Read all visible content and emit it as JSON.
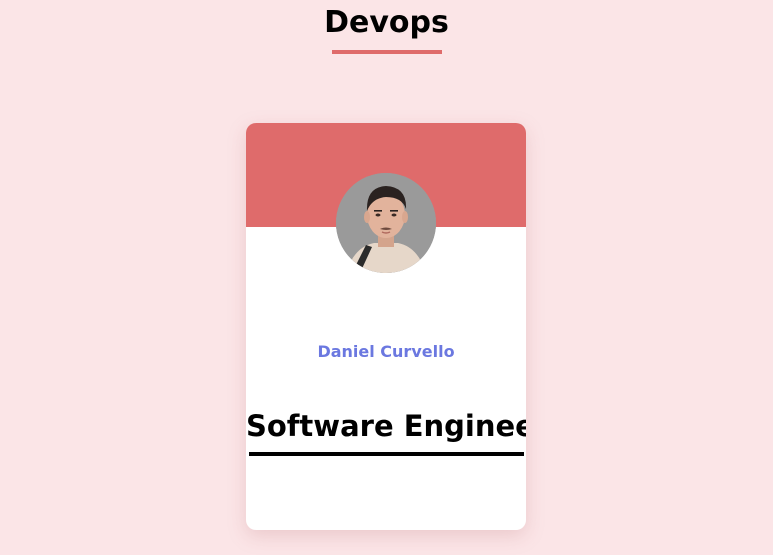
{
  "header": {
    "title": "Devops"
  },
  "card": {
    "name": "Daniel Curvello",
    "role": "Software Engineer"
  },
  "colors": {
    "background": "#fbe5e7",
    "accent": "#df6b6b",
    "name_color": "#6b78e0",
    "card_background": "#ffffff"
  }
}
